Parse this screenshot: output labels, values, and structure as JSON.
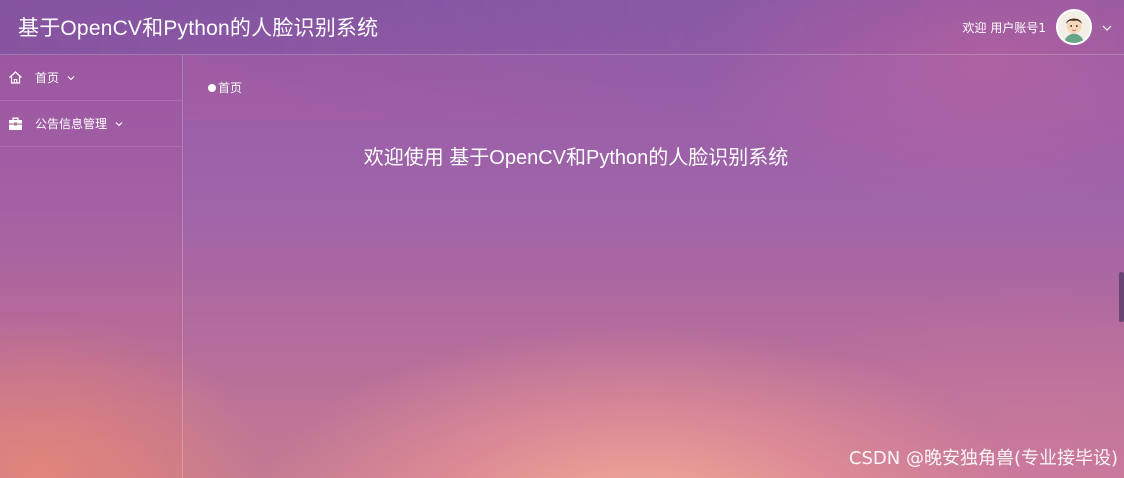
{
  "header": {
    "app_title": "基于OpenCV和Python的人脸识别系统",
    "welcome_user": "欢迎 用户账号1",
    "avatar_icon": "user-avatar-icon",
    "menu_icon": "chevron-down-icon"
  },
  "sidebar": {
    "items": [
      {
        "label": "首页",
        "icon": "home-icon"
      },
      {
        "label": "公告信息管理",
        "icon": "briefcase-icon"
      }
    ]
  },
  "breadcrumb": {
    "current": "首页"
  },
  "main": {
    "welcome_text": "欢迎使用 基于OpenCV和Python的人脸识别系统"
  },
  "watermark": "CSDN @晚安独角兽(专业接毕设)"
}
